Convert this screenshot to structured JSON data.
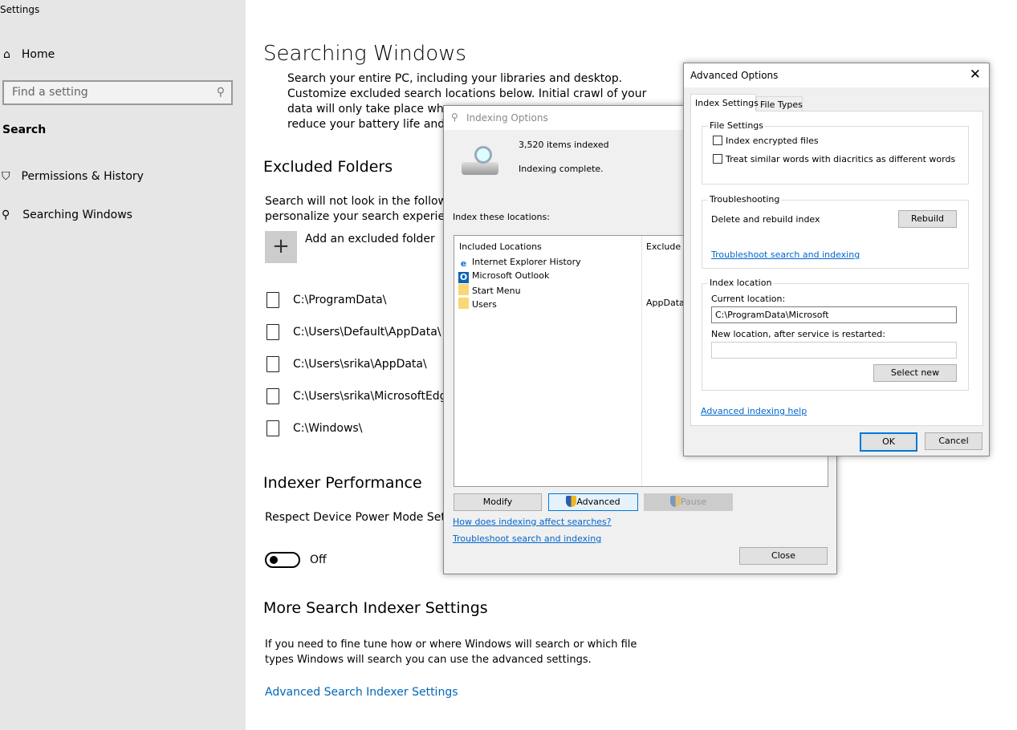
{
  "window": {
    "title": "Settings"
  },
  "sidebar": {
    "home": "Home",
    "search_placeholder": "Find a setting",
    "section": "Search",
    "items": [
      {
        "label": "Permissions & History",
        "icon": "shield-monitor-icon"
      },
      {
        "label": "Searching Windows",
        "icon": "search-icon"
      }
    ]
  },
  "main": {
    "title": "Searching Windows",
    "intro": [
      "Search your entire PC, including your libraries and desktop.",
      "Customize excluded search locations below. Initial crawl of your",
      "data will only take place when c",
      "reduce your battery life and inc"
    ],
    "excluded": {
      "title": "Excluded Folders",
      "desc": [
        "Search will not look in the following",
        "personalize your search experience."
      ],
      "add_label": "Add an excluded folder",
      "folders": [
        "C:\\ProgramData\\",
        "C:\\Users\\Default\\AppData\\",
        "C:\\Users\\srika\\AppData\\",
        "C:\\Users\\srika\\MicrosoftEdgeB",
        "C:\\Windows\\"
      ]
    },
    "perf": {
      "title": "Indexer Performance",
      "desc": "Respect Device Power Mode Setting",
      "toggle_state": "Off"
    },
    "more": {
      "title": "More Search Indexer Settings",
      "desc": [
        "If you need to fine tune how or where Windows will search or which file",
        "types Windows will search you can use the advanced settings."
      ],
      "link": "Advanced Search Indexer Settings"
    }
  },
  "indexing": {
    "title": "Indexing Options",
    "count": "3,520 items indexed",
    "status": "Indexing complete.",
    "locations_label": "Index these locations:",
    "col_included": "Included Locations",
    "col_exclude": "Exclude",
    "rows": [
      {
        "name": "Internet Explorer History",
        "exclude": ""
      },
      {
        "name": "Microsoft Outlook",
        "exclude": ""
      },
      {
        "name": "Start Menu",
        "exclude": ""
      },
      {
        "name": "Users",
        "exclude": "AppData;"
      }
    ],
    "modify": "Modify",
    "advanced": "Advanced",
    "pause": "Pause",
    "link1": "How does indexing affect searches?",
    "link2": "Troubleshoot search and indexing",
    "close": "Close"
  },
  "advanced": {
    "title": "Advanced Options",
    "tabs": [
      "Index Settings",
      "File Types"
    ],
    "file_settings": {
      "label": "File Settings",
      "options": [
        {
          "label": "Index encrypted files",
          "checked": false
        },
        {
          "label": "Treat similar words with diacritics as different words",
          "checked": false
        }
      ]
    },
    "troubleshooting": {
      "label": "Troubleshooting",
      "rebuild_text": "Delete and rebuild index",
      "rebuild": "Rebuild",
      "link": "Troubleshoot search and indexing"
    },
    "location": {
      "label": "Index location",
      "current_label": "Current location:",
      "current_value": "C:\\ProgramData\\Microsoft",
      "new_label": "New location, after service is restarted:",
      "new_value": "",
      "select_new": "Select new"
    },
    "help_link": "Advanced indexing help",
    "ok": "OK",
    "cancel": "Cancel"
  }
}
